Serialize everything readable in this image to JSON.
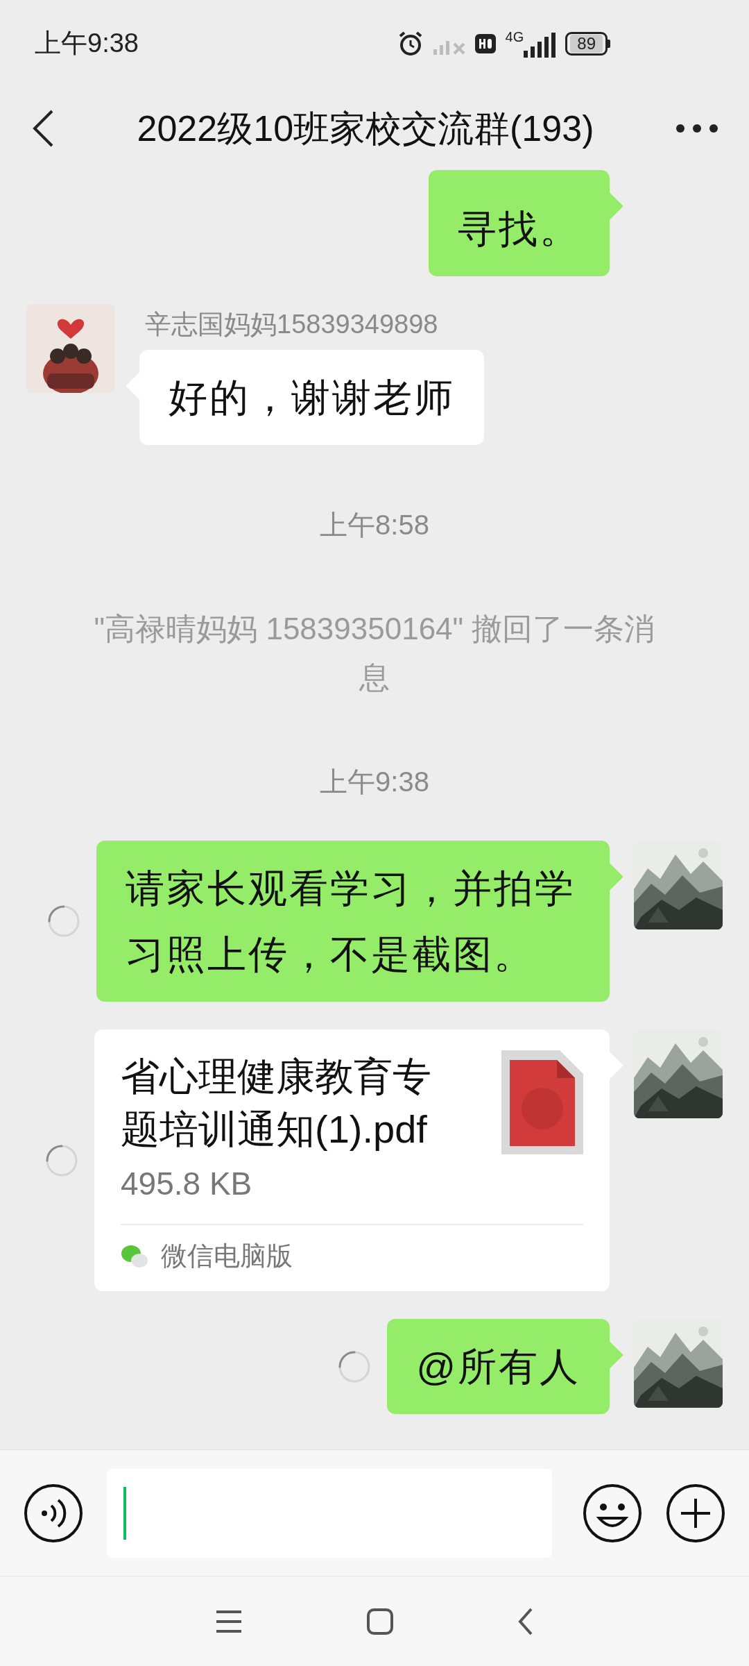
{
  "status_bar": {
    "time": "上午9:38",
    "network": "4G",
    "battery": "89"
  },
  "header": {
    "title": "2022级10班家校交流群(193)"
  },
  "messages": [
    {
      "kind": "text",
      "outgoing": true,
      "text": "寻找。",
      "sending": false,
      "avatar_visible": false
    },
    {
      "kind": "text",
      "outgoing": false,
      "sender": "辛志国妈妈15839349898",
      "text": "好的，谢谢老师",
      "avatar_visible": true
    },
    {
      "kind": "time",
      "text": "上午8:58"
    },
    {
      "kind": "notice",
      "text": "\"高禄晴妈妈 15839350164\" 撤回了一条消息"
    },
    {
      "kind": "time",
      "text": "上午9:38"
    },
    {
      "kind": "text",
      "outgoing": true,
      "text": "请家长观看学习，并拍学习照上传，不是截图。",
      "sending": true,
      "avatar_visible": true
    },
    {
      "kind": "file",
      "outgoing": true,
      "name": "省心理健康教育专题培训通知(1).pdf",
      "size": "495.8 KB",
      "source": "微信电脑版",
      "sending": true,
      "avatar_visible": true
    },
    {
      "kind": "text",
      "outgoing": true,
      "text": "@所有人",
      "sending": true,
      "avatar_visible": true
    }
  ]
}
